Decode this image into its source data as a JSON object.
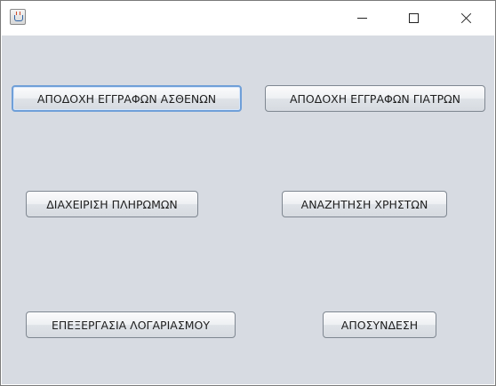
{
  "window": {
    "app_icon": "java-cup-icon"
  },
  "titlebar": {
    "minimize_icon": "minimize-icon",
    "maximize_icon": "maximize-icon",
    "close_icon": "close-icon"
  },
  "buttons": {
    "accept_patient_registrations": "ΑΠΟΔΟΧΗ ΕΓΓΡΑΦΩΝ ΑΣΘΕΝΩΝ",
    "accept_doctor_registrations": "ΑΠΟΔΟΧΗ ΕΓΓΡΑΦΩΝ ΓΙΑΤΡΩΝ",
    "manage_payments": "ΔΙΑΧΕΙΡΙΣΗ ΠΛΗΡΩΜΩΝ",
    "search_users": "ΑΝΑΖΗΤΗΣΗ ΧΡΗΣΤΩΝ",
    "edit_account": "ΕΠΕΞΕΡΓΑΣΙΑ ΛΟΓΑΡΙΑΣΜΟΥ",
    "logout": "ΑΠΟΣΥΝΔΕΣΗ"
  },
  "colors": {
    "panel_background": "#d7dbe2",
    "focus_ring": "#6f9fd8"
  }
}
